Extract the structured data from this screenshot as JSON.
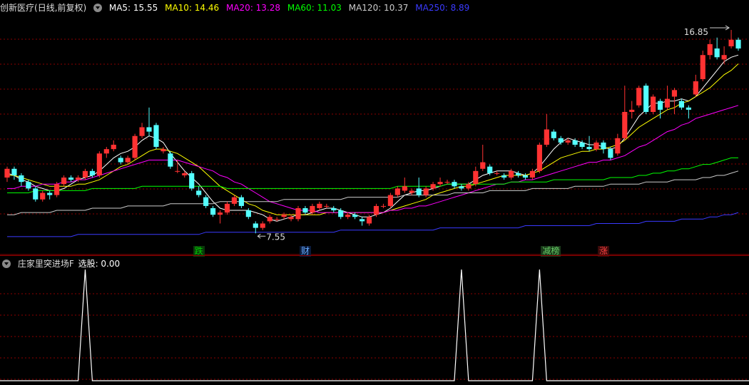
{
  "top": {
    "stock_name": "创新医疗",
    "mode": "(日线,前复权)",
    "ma": [
      {
        "label": "MA5: 15.55",
        "color": "#ffffff"
      },
      {
        "label": "MA10: 14.46",
        "color": "#ffff00"
      },
      {
        "label": "MA20: 13.28",
        "color": "#ff00ff"
      },
      {
        "label": "MA60: 11.03",
        "color": "#00ff00"
      },
      {
        "label": "MA120: 10.37",
        "color": "#cccccc"
      },
      {
        "label": "MA250: 8.89",
        "color": "#3a3aff"
      }
    ]
  },
  "price_markers": {
    "high": "16.85",
    "low": "7.55"
  },
  "events": [
    {
      "label": "跌",
      "color": "#00cc00",
      "bg": "#0a3a0a"
    },
    {
      "label": "财",
      "color": "#66aaff",
      "bg": "#0a1a3a"
    },
    {
      "label": "减榜",
      "color": "#66cc66",
      "bg": "#1a3a1a"
    },
    {
      "label": "涨",
      "color": "#ff4040",
      "bg": "#3a0a0a"
    }
  ],
  "bottom": {
    "indicator_name": "庄家里突进场F",
    "indicator_value": "选股: 0.00"
  },
  "chart_data": {
    "type": "candlestick",
    "colors": {
      "up": "#ff3232",
      "down": "#54ffff",
      "grid": "#8b0000"
    },
    "candles": [
      [
        10.1,
        10.5,
        10.6,
        9.9
      ],
      [
        10.5,
        10.2,
        10.6,
        10.0
      ],
      [
        10.2,
        9.9,
        10.3,
        9.7
      ],
      [
        9.9,
        9.6,
        10.0,
        9.5
      ],
      [
        9.6,
        9.1,
        9.7,
        9.0
      ],
      [
        9.1,
        9.4,
        9.5,
        9.0
      ],
      [
        9.4,
        9.3,
        9.5,
        9.1
      ],
      [
        9.3,
        9.8,
        9.9,
        9.2
      ],
      [
        9.8,
        10.1,
        10.2,
        9.7
      ],
      [
        10.1,
        10.0,
        10.2,
        9.9
      ],
      [
        10.0,
        10.1,
        10.2,
        9.9
      ],
      [
        10.1,
        10.4,
        10.5,
        10.0
      ],
      [
        10.4,
        10.2,
        10.5,
        10.1
      ],
      [
        10.2,
        11.2,
        11.3,
        10.1
      ],
      [
        11.2,
        11.4,
        11.5,
        11.0
      ],
      [
        11.4,
        11.6,
        11.8,
        11.3
      ],
      [
        11.0,
        10.8,
        11.1,
        10.7
      ],
      [
        10.8,
        11.0,
        11.1,
        10.7
      ],
      [
        11.0,
        12.0,
        12.1,
        10.9
      ],
      [
        12.0,
        12.4,
        12.6,
        11.9
      ],
      [
        12.4,
        12.2,
        13.3,
        12.0
      ],
      [
        12.5,
        11.5,
        12.6,
        11.4
      ],
      [
        11.3,
        11.4,
        11.5,
        11.2
      ],
      [
        11.2,
        10.6,
        11.3,
        10.5
      ],
      [
        10.4,
        10.4,
        10.9,
        10.3
      ],
      [
        10.2,
        10.3,
        10.4,
        10.1
      ],
      [
        10.3,
        9.6,
        10.4,
        9.5
      ],
      [
        9.5,
        9.3,
        9.7,
        9.2
      ],
      [
        9.2,
        8.8,
        9.3,
        8.7
      ],
      [
        8.7,
        8.4,
        8.8,
        8.3
      ],
      [
        8.4,
        8.5,
        8.6,
        8.0
      ],
      [
        8.5,
        8.9,
        9.0,
        8.4
      ],
      [
        8.9,
        9.2,
        9.3,
        8.8
      ],
      [
        9.2,
        8.8,
        9.3,
        8.7
      ],
      [
        8.6,
        8.3,
        8.7,
        8.2
      ],
      [
        8.0,
        7.8,
        8.1,
        7.55
      ],
      [
        7.8,
        8.0,
        8.1,
        7.7
      ],
      [
        8.1,
        8.3,
        8.4,
        8.0
      ],
      [
        8.2,
        8.2,
        8.3,
        8.1
      ],
      [
        8.3,
        8.4,
        8.5,
        8.2
      ],
      [
        8.2,
        8.3,
        8.4,
        8.1
      ],
      [
        8.2,
        8.7,
        8.8,
        8.1
      ],
      [
        8.7,
        8.5,
        8.8,
        8.4
      ],
      [
        8.5,
        8.8,
        8.9,
        8.4
      ],
      [
        8.7,
        8.9,
        9.0,
        8.6
      ],
      [
        8.8,
        8.8,
        8.9,
        8.7
      ],
      [
        8.7,
        8.6,
        8.8,
        8.5
      ],
      [
        8.6,
        8.3,
        8.7,
        8.2
      ],
      [
        8.3,
        8.4,
        8.5,
        8.2
      ],
      [
        8.4,
        8.3,
        8.5,
        8.2
      ],
      [
        8.2,
        8.1,
        8.3,
        7.9
      ],
      [
        8.0,
        8.3,
        8.4,
        7.9
      ],
      [
        8.4,
        8.8,
        8.9,
        8.3
      ],
      [
        8.8,
        8.8,
        8.9,
        8.7
      ],
      [
        8.8,
        9.3,
        9.4,
        8.7
      ],
      [
        9.3,
        9.6,
        9.7,
        9.2
      ],
      [
        9.5,
        9.7,
        10.1,
        9.4
      ],
      [
        9.4,
        9.5,
        9.6,
        9.3
      ],
      [
        9.6,
        9.3,
        10.1,
        9.2
      ],
      [
        9.3,
        9.6,
        9.7,
        9.2
      ],
      [
        9.6,
        9.8,
        9.9,
        9.5
      ],
      [
        9.8,
        9.9,
        10.1,
        9.7
      ],
      [
        9.9,
        9.9,
        10.0,
        9.8
      ],
      [
        9.9,
        9.7,
        10.0,
        9.6
      ],
      [
        9.7,
        9.6,
        9.8,
        9.5
      ],
      [
        9.6,
        9.8,
        9.9,
        9.5
      ],
      [
        9.8,
        10.4,
        10.6,
        9.7
      ],
      [
        10.5,
        10.8,
        11.6,
        10.4
      ],
      [
        10.6,
        10.3,
        10.7,
        10.2
      ],
      [
        10.3,
        10.3,
        10.4,
        10.2
      ],
      [
        10.2,
        10.1,
        10.3,
        10.0
      ],
      [
        10.1,
        10.4,
        10.5,
        10.0
      ],
      [
        10.3,
        10.2,
        10.4,
        10.1
      ],
      [
        10.2,
        10.1,
        10.3,
        10.0
      ],
      [
        10.1,
        10.4,
        10.5,
        10.0
      ],
      [
        10.4,
        11.6,
        11.7,
        10.3
      ],
      [
        11.6,
        12.3,
        13.0,
        11.5
      ],
      [
        12.2,
        11.9,
        12.3,
        11.8
      ],
      [
        11.9,
        11.7,
        12.0,
        11.6
      ],
      [
        11.7,
        11.8,
        11.9,
        11.6
      ],
      [
        11.8,
        11.6,
        11.9,
        11.5
      ],
      [
        11.7,
        11.5,
        11.8,
        11.4
      ],
      [
        11.5,
        11.4,
        12.0,
        11.3
      ],
      [
        11.4,
        11.7,
        11.8,
        11.3
      ],
      [
        11.7,
        11.4,
        11.8,
        11.2
      ],
      [
        11.4,
        11.0,
        11.5,
        10.9
      ],
      [
        11.2,
        11.9,
        12.1,
        11.1
      ],
      [
        11.9,
        13.1,
        14.3,
        11.8
      ],
      [
        13.1,
        13.2,
        13.6,
        12.8
      ],
      [
        13.4,
        14.2,
        14.3,
        13.3
      ],
      [
        14.3,
        13.1,
        14.4,
        13.0
      ],
      [
        13.1,
        13.8,
        13.9,
        13.0
      ],
      [
        13.6,
        13.2,
        13.7,
        12.8
      ],
      [
        13.3,
        13.7,
        14.3,
        13.2
      ],
      [
        13.8,
        14.1,
        14.2,
        13.0
      ],
      [
        13.6,
        13.3,
        13.7,
        13.2
      ],
      [
        13.3,
        13.2,
        13.4,
        12.8
      ],
      [
        13.9,
        14.5,
        14.8,
        13.8
      ],
      [
        14.6,
        15.7,
        15.9,
        14.5
      ],
      [
        15.7,
        16.2,
        16.4,
        15.5
      ],
      [
        16.0,
        15.6,
        16.5,
        15.5
      ],
      [
        15.5,
        15.7,
        16.1,
        15.3
      ],
      [
        16.1,
        16.4,
        16.85,
        16.0
      ],
      [
        16.4,
        16.0,
        16.5,
        15.9
      ]
    ],
    "ma_series": [
      {
        "name": "MA5",
        "color": "#ffffff",
        "values": [
          10.3,
          10.2,
          10.0,
          9.9,
          9.7,
          9.6,
          9.5,
          9.5,
          9.6,
          9.8,
          10.0,
          10.1,
          10.2,
          10.4,
          10.7,
          11.0,
          11.2,
          11.3,
          11.5,
          11.8,
          12.0,
          11.9,
          11.7,
          11.2,
          10.8,
          10.4,
          10.1,
          9.8,
          9.4,
          9.0,
          8.7,
          8.6,
          8.6,
          8.6,
          8.6,
          8.5,
          8.4,
          8.2,
          8.1,
          8.2,
          8.3,
          8.4,
          8.4,
          8.5,
          8.6,
          8.7,
          8.7,
          8.6,
          8.5,
          8.4,
          8.3,
          8.3,
          8.4,
          8.5,
          8.7,
          9.0,
          9.3,
          9.4,
          9.5,
          9.5,
          9.6,
          9.7,
          9.8,
          9.8,
          9.8,
          9.8,
          10.0,
          10.2,
          10.3,
          10.4,
          10.4,
          10.4,
          10.3,
          10.2,
          10.3,
          10.6,
          11.0,
          11.4,
          11.7,
          11.9,
          11.8,
          11.7,
          11.6,
          11.6,
          11.5,
          11.4,
          11.5,
          11.9,
          12.4,
          12.9,
          13.2,
          13.5,
          13.5,
          13.6,
          13.6,
          13.7,
          13.6,
          13.8,
          14.2,
          14.6,
          15.0,
          15.4,
          15.6,
          15.7
        ]
      },
      {
        "name": "MA10",
        "color": "#ffff00",
        "values": [
          10.2,
          10.2,
          10.1,
          10.0,
          9.9,
          9.8,
          9.7,
          9.7,
          9.7,
          9.7,
          9.8,
          9.8,
          9.9,
          10.0,
          10.2,
          10.4,
          10.6,
          10.7,
          10.9,
          11.1,
          11.3,
          11.4,
          11.4,
          11.3,
          11.2,
          11.0,
          10.8,
          10.6,
          10.3,
          10.0,
          9.7,
          9.5,
          9.3,
          9.1,
          8.9,
          8.8,
          8.6,
          8.5,
          8.4,
          8.4,
          8.4,
          8.4,
          8.4,
          8.4,
          8.4,
          8.5,
          8.5,
          8.5,
          8.5,
          8.5,
          8.5,
          8.5,
          8.5,
          8.5,
          8.6,
          8.7,
          8.8,
          8.9,
          9.0,
          9.1,
          9.3,
          9.4,
          9.5,
          9.6,
          9.7,
          9.7,
          9.8,
          9.9,
          10.0,
          10.1,
          10.2,
          10.2,
          10.2,
          10.2,
          10.3,
          10.4,
          10.6,
          10.8,
          11.0,
          11.1,
          11.2,
          11.3,
          11.3,
          11.4,
          11.4,
          11.5,
          11.6,
          11.8,
          12.1,
          12.4,
          12.6,
          12.8,
          13.0,
          13.2,
          13.3,
          13.5,
          13.6,
          13.8,
          14.0,
          14.2,
          14.5,
          14.8,
          15.0,
          15.3
        ]
      },
      {
        "name": "MA20",
        "color": "#ff00ff",
        "values": [
          9.6,
          9.6,
          9.7,
          9.7,
          9.7,
          9.8,
          9.8,
          9.8,
          9.9,
          9.9,
          10.0,
          10.0,
          10.1,
          10.2,
          10.3,
          10.4,
          10.5,
          10.6,
          10.7,
          10.8,
          10.9,
          10.9,
          10.9,
          10.9,
          10.9,
          10.8,
          10.7,
          10.6,
          10.5,
          10.4,
          10.2,
          10.1,
          9.9,
          9.8,
          9.6,
          9.4,
          9.2,
          9.0,
          8.9,
          8.8,
          8.7,
          8.6,
          8.6,
          8.6,
          8.5,
          8.5,
          8.5,
          8.5,
          8.5,
          8.5,
          8.5,
          8.5,
          8.5,
          8.5,
          8.6,
          8.6,
          8.7,
          8.7,
          8.8,
          8.8,
          8.9,
          9.0,
          9.1,
          9.2,
          9.3,
          9.4,
          9.5,
          9.6,
          9.7,
          9.8,
          9.8,
          9.9,
          9.9,
          10.0,
          10.0,
          10.1,
          10.2,
          10.3,
          10.4,
          10.5,
          10.6,
          10.7,
          10.8,
          10.8,
          10.9,
          10.9,
          11.0,
          11.1,
          11.3,
          11.5,
          11.6,
          11.8,
          12.0,
          12.2,
          12.3,
          12.5,
          12.6,
          12.8,
          12.9,
          13.0,
          13.1,
          13.2,
          13.3,
          13.4
        ]
      },
      {
        "name": "MA60",
        "color": "#00ff00",
        "values": [
          9.4,
          9.4,
          9.4,
          9.4,
          9.5,
          9.5,
          9.5,
          9.5,
          9.5,
          9.5,
          9.5,
          9.5,
          9.6,
          9.6,
          9.6,
          9.6,
          9.6,
          9.6,
          9.6,
          9.7,
          9.7,
          9.7,
          9.7,
          9.7,
          9.7,
          9.7,
          9.7,
          9.7,
          9.7,
          9.7,
          9.7,
          9.6,
          9.6,
          9.6,
          9.6,
          9.6,
          9.6,
          9.6,
          9.6,
          9.6,
          9.6,
          9.6,
          9.6,
          9.6,
          9.6,
          9.6,
          9.6,
          9.6,
          9.6,
          9.6,
          9.6,
          9.6,
          9.6,
          9.6,
          9.6,
          9.7,
          9.7,
          9.7,
          9.7,
          9.7,
          9.7,
          9.7,
          9.8,
          9.8,
          9.8,
          9.8,
          9.8,
          9.8,
          9.8,
          9.8,
          9.8,
          9.9,
          9.9,
          9.9,
          9.9,
          9.9,
          9.9,
          10.0,
          10.0,
          10.0,
          10.0,
          10.0,
          10.0,
          10.0,
          10.0,
          10.1,
          10.1,
          10.1,
          10.1,
          10.2,
          10.2,
          10.3,
          10.3,
          10.4,
          10.4,
          10.5,
          10.5,
          10.6,
          10.7,
          10.7,
          10.8,
          10.9,
          11.0,
          11.0
        ]
      },
      {
        "name": "MA120",
        "color": "#cccccc",
        "values": [
          8.4,
          8.4,
          8.5,
          8.5,
          8.5,
          8.5,
          8.5,
          8.6,
          8.6,
          8.6,
          8.6,
          8.6,
          8.7,
          8.7,
          8.7,
          8.7,
          8.7,
          8.8,
          8.8,
          8.8,
          8.8,
          8.8,
          8.8,
          8.9,
          8.9,
          8.9,
          8.9,
          8.9,
          8.9,
          8.9,
          9.0,
          9.0,
          9.0,
          9.0,
          9.0,
          9.0,
          9.0,
          9.0,
          9.0,
          9.1,
          9.1,
          9.1,
          9.1,
          9.1,
          9.1,
          9.1,
          9.1,
          9.1,
          9.2,
          9.2,
          9.2,
          9.2,
          9.2,
          9.2,
          9.2,
          9.2,
          9.3,
          9.3,
          9.3,
          9.3,
          9.3,
          9.3,
          9.3,
          9.4,
          9.4,
          9.4,
          9.4,
          9.4,
          9.5,
          9.5,
          9.5,
          9.5,
          9.5,
          9.5,
          9.6,
          9.6,
          9.6,
          9.6,
          9.6,
          9.6,
          9.7,
          9.7,
          9.7,
          9.7,
          9.7,
          9.8,
          9.8,
          9.8,
          9.8,
          9.8,
          9.9,
          9.9,
          9.9,
          9.9,
          10.0,
          10.0,
          10.0,
          10.0,
          10.1,
          10.1,
          10.2,
          10.2,
          10.3,
          10.4
        ]
      },
      {
        "name": "MA250",
        "color": "#3a3aff",
        "values": [
          7.4,
          7.4,
          7.4,
          7.4,
          7.4,
          7.4,
          7.4,
          7.4,
          7.4,
          7.4,
          7.5,
          7.5,
          7.5,
          7.5,
          7.5,
          7.5,
          7.5,
          7.5,
          7.5,
          7.5,
          7.5,
          7.5,
          7.5,
          7.5,
          7.5,
          7.5,
          7.5,
          7.5,
          7.6,
          7.6,
          7.6,
          7.6,
          7.6,
          7.6,
          7.6,
          7.6,
          7.6,
          7.6,
          7.6,
          7.6,
          7.6,
          7.6,
          7.6,
          7.6,
          7.6,
          7.6,
          7.6,
          7.7,
          7.7,
          7.7,
          7.7,
          7.7,
          7.7,
          7.7,
          7.7,
          7.7,
          7.7,
          7.7,
          7.7,
          7.7,
          7.7,
          7.8,
          7.8,
          7.8,
          7.8,
          7.8,
          7.8,
          7.8,
          7.8,
          7.8,
          7.8,
          7.8,
          7.8,
          7.9,
          7.9,
          7.9,
          7.9,
          7.9,
          7.9,
          7.9,
          7.9,
          7.9,
          7.9,
          8.0,
          8.0,
          8.0,
          8.0,
          8.0,
          8.0,
          8.0,
          8.1,
          8.1,
          8.1,
          8.1,
          8.1,
          8.2,
          8.2,
          8.2,
          8.2,
          8.3,
          8.3,
          8.4,
          8.4,
          8.5
        ]
      }
    ],
    "event_index": [
      27,
      42,
      76,
      84
    ],
    "signal": {
      "peaks": [
        11,
        64,
        75
      ],
      "value_range": [
        0,
        1
      ]
    },
    "ylim": [
      7.2,
      17.5
    ]
  }
}
